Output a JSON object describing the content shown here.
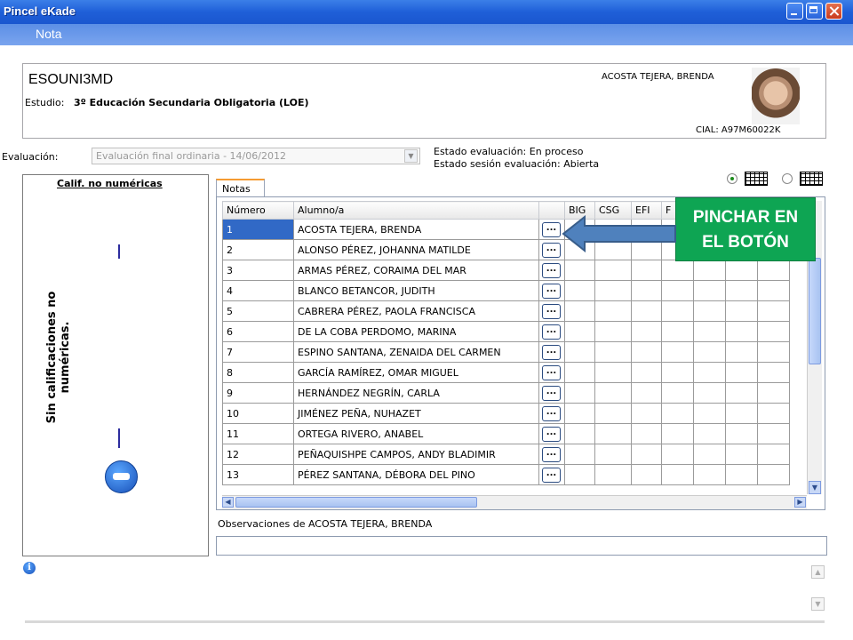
{
  "window": {
    "title": "Pincel eKade"
  },
  "subbar": {
    "label": "Nota"
  },
  "header": {
    "course": "ESOUNI3MD",
    "study_label": "Estudio:",
    "study_value": "3º Educación Secundaria Obligatoria (LOE)",
    "student_name": "ACOSTA TEJERA, BRENDA",
    "cial": "CIAL:  A97M60022K"
  },
  "evaluation": {
    "label": "Evaluación:",
    "selected": "Evaluación final ordinaria - 14/06/2012",
    "status_line1": "Estado evaluación: En proceso",
    "status_line2": "Estado sesión evaluación: Abierta"
  },
  "left_panel": {
    "header": "Calif. no numéricas",
    "vertical_text": "Sin calificaciones no numéricas."
  },
  "tab": {
    "label": "Notas"
  },
  "table": {
    "columns": [
      "Número",
      "Alumno/a",
      "",
      "BIG",
      "CSG",
      "EFI",
      "F"
    ],
    "button_label": "...",
    "rows": [
      {
        "num": "1",
        "name": "ACOSTA TEJERA, BRENDA"
      },
      {
        "num": "2",
        "name": "ALONSO PÉREZ, JOHANNA MATILDE"
      },
      {
        "num": "3",
        "name": "ARMAS PÉREZ, CORAIMA DEL MAR"
      },
      {
        "num": "4",
        "name": "BLANCO BETANCOR, JUDITH"
      },
      {
        "num": "5",
        "name": "CABRERA PÉREZ, PAOLA FRANCISCA"
      },
      {
        "num": "6",
        "name": "DE LA COBA PERDOMO, MARINA"
      },
      {
        "num": "7",
        "name": "ESPINO SANTANA, ZENAIDA DEL CARMEN"
      },
      {
        "num": "8",
        "name": "GARCÍA RAMÍREZ, OMAR MIGUEL"
      },
      {
        "num": "9",
        "name": "HERNÁNDEZ NEGRÍN, CARLA"
      },
      {
        "num": "10",
        "name": "JIMÉNEZ PEÑA, NUHAZET"
      },
      {
        "num": "11",
        "name": "ORTEGA RIVERO, ANABEL"
      },
      {
        "num": "12",
        "name": "PEÑAQUISHPE CAMPOS, ANDY BLADIMIR"
      },
      {
        "num": "13",
        "name": "PÉREZ SANTANA, DÉBORA DEL PINO"
      }
    ]
  },
  "callout": {
    "line1": "PINCHAR EN",
    "line2": "EL BOTÓN",
    "color": "#0ea553"
  },
  "observations": {
    "label": "Observaciones de ACOSTA TEJERA, BRENDA",
    "value": ""
  },
  "icons": {
    "info": "info-icon",
    "key": "key-icon"
  }
}
